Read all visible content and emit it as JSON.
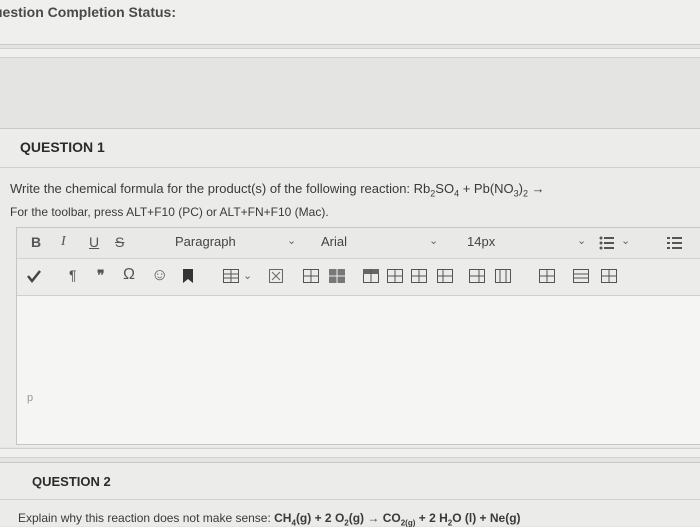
{
  "status": {
    "title": "uestion Completion Status:"
  },
  "question1": {
    "title": "QUESTION 1",
    "prompt_text": "Write the chemical formula for the product(s) of the following reaction: Rb",
    "prompt_sub1": "2",
    "prompt_mid1": "SO",
    "prompt_sub2": "4",
    "prompt_mid2": " + Pb(NO",
    "prompt_sub3": "3",
    "prompt_mid3": ")",
    "prompt_sub4": "2",
    "prompt_arrow": " →",
    "toolbar_hint": "For the toolbar, press ALT+F10 (PC) or ALT+FN+F10 (Mac)."
  },
  "toolbar": {
    "bold": "B",
    "italic": "I",
    "underline": "U",
    "strike": "S",
    "paragraph": "Paragraph",
    "font": "Arial",
    "size": "14px",
    "pilcrow": "¶",
    "quote": "❞",
    "omega": "Ω",
    "smiley": "☺"
  },
  "editor": {
    "path": "p"
  },
  "question2": {
    "title": "QUESTION 2",
    "prompt_start": "Explain why this reaction does not make sense: ",
    "eq1": "CH",
    "eq1s": "4",
    "eq2": "(g) + 2 O",
    "eq2s": "2",
    "eq3": "(g) → CO",
    "eq3s": "2(g)",
    "eq4": " + 2 H",
    "eq4s": "2",
    "eq5": "O (l) + Ne(g)"
  }
}
